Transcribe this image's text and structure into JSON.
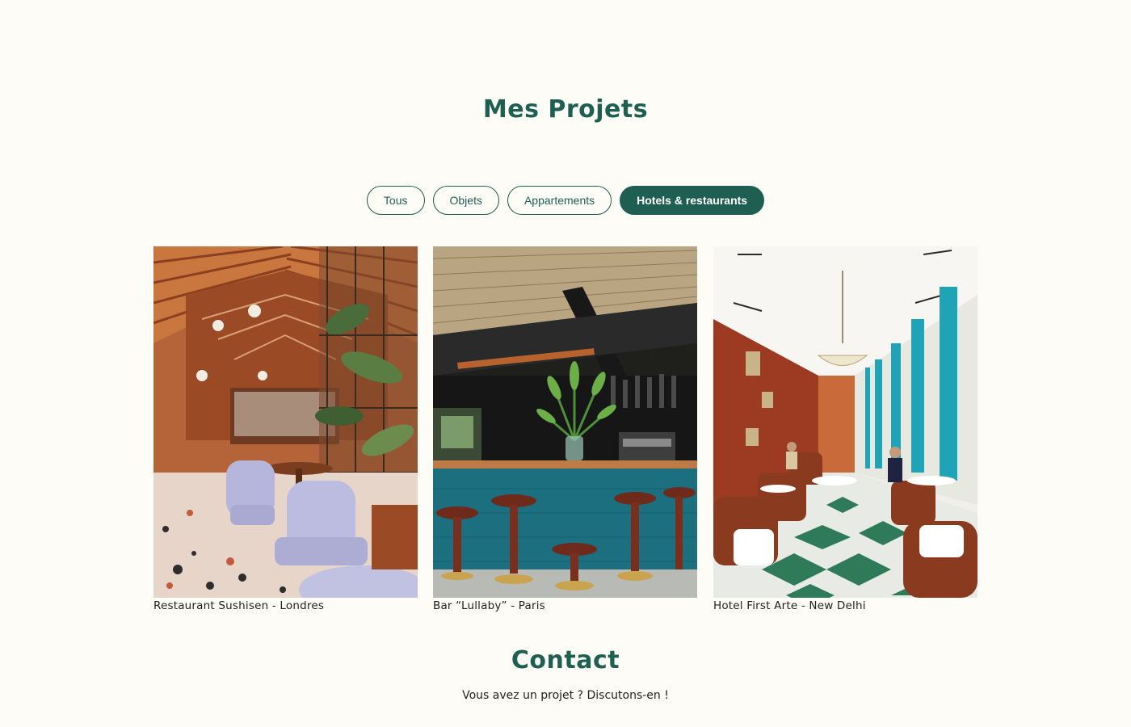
{
  "projects": {
    "title": "Mes Projets",
    "filters": [
      {
        "label": "Tous",
        "active": false
      },
      {
        "label": "Objets",
        "active": false
      },
      {
        "label": "Appartements",
        "active": false
      },
      {
        "label": "Hotels & restaurants",
        "active": true
      }
    ],
    "items": [
      {
        "caption": "Restaurant Sushisen - Londres",
        "image": "restaurant-interior-photo"
      },
      {
        "caption": "Bar “Lullaby” - Paris",
        "image": "bar-interior-photo"
      },
      {
        "caption": "Hotel First Arte - New Delhi",
        "image": "hotel-dining-hall-photo"
      }
    ]
  },
  "contact": {
    "title": "Contact",
    "text": "Vous avez un projet ? Discutons-en !"
  },
  "colors": {
    "accent": "#1f5f52",
    "background": "#fdfcf7"
  }
}
